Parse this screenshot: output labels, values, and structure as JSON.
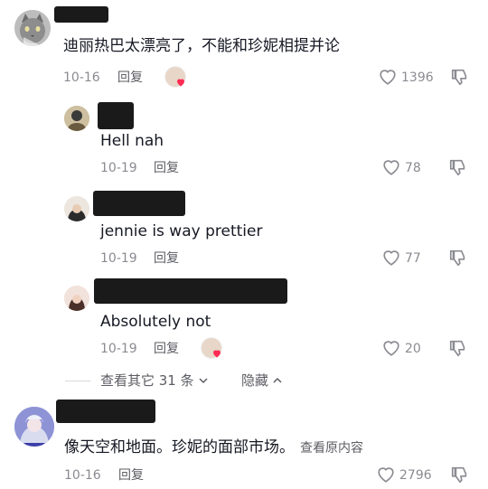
{
  "comments": [
    {
      "text": "迪丽热巴太漂亮了，不能和珍妮相提并论",
      "date": "10-16",
      "reply_label": "回复",
      "likes": "1396",
      "avatar_icon": "cat-avatar-icon",
      "has_creator_badge": true
    }
  ],
  "replies": [
    {
      "text": "Hell nah",
      "date": "10-19",
      "reply_label": "回复",
      "likes": "78",
      "has_creator_badge": false
    },
    {
      "text": "jennie is way prettier",
      "date": "10-19",
      "reply_label": "回复",
      "likes": "77",
      "has_creator_badge": false
    },
    {
      "text": "Absolutely not",
      "date": "10-19",
      "reply_label": "回复",
      "likes": "20",
      "has_creator_badge": true
    }
  ],
  "thread_controls": {
    "more_label": "查看其它 31 条",
    "hide_label": "隐藏"
  },
  "comment2": {
    "text": "像天空和地面。珍妮的面部市场。",
    "see_original": "查看原内容",
    "date": "10-16",
    "reply_label": "回复",
    "likes": "2796"
  },
  "colors": {
    "text": "#161823",
    "meta": "#8a8b91",
    "heart_badge": "#fe2c55"
  }
}
